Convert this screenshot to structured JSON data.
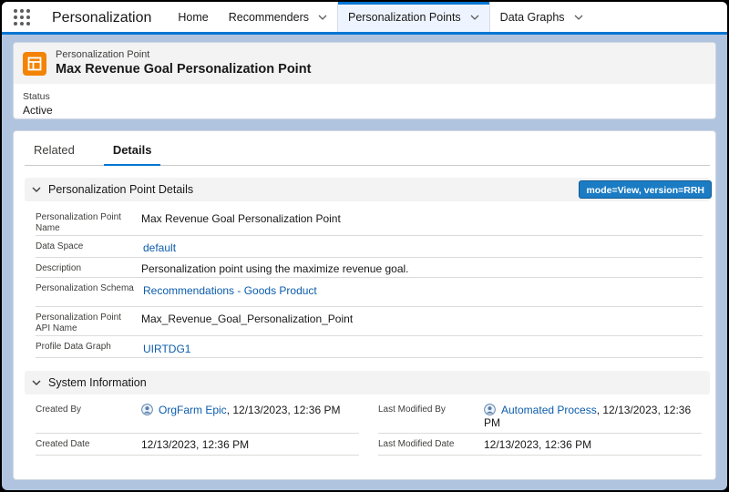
{
  "nav": {
    "app_name": "Personalization",
    "tabs": [
      {
        "label": "Home"
      },
      {
        "label": "Recommenders"
      },
      {
        "label": "Personalization Points"
      },
      {
        "label": "Data Graphs"
      }
    ]
  },
  "record": {
    "object_type": "Personalization Point",
    "title": "Max Revenue Goal Personalization Point",
    "status_label": "Status",
    "status_value": "Active"
  },
  "tabs": {
    "related": "Related",
    "details": "Details"
  },
  "details_section": {
    "title": "Personalization Point Details",
    "mode_badge": "mode=View, version=RRH",
    "fields": [
      {
        "label": "Personalization Point Name",
        "value": "Max Revenue Goal Personalization Point"
      },
      {
        "label": "Data Space",
        "value": "default"
      },
      {
        "label": "Description",
        "value": "Personalization point using the maximize revenue goal."
      },
      {
        "label": "Personalization Schema",
        "value": "Recommendations - Goods Product"
      },
      {
        "label": "Personalization Point API Name",
        "value": "Max_Revenue_Goal_Personalization_Point"
      },
      {
        "label": "Profile Data Graph",
        "value": "UIRTDG1"
      }
    ]
  },
  "system_section": {
    "title": "System Information",
    "created_by_label": "Created By",
    "created_by_user": "OrgFarm Epic",
    "created_by_date": ", 12/13/2023, 12:36 PM",
    "created_date_label": "Created Date",
    "created_date_value": "12/13/2023, 12:36 PM",
    "modified_by_label": "Last Modified By",
    "modified_by_user": "Automated Process",
    "modified_by_date_1": ", 12/13/2023, 12:36",
    "modified_by_date_2": "PM",
    "modified_date_label": "Last Modified Date",
    "modified_date_value": "12/13/2023, 12:36 PM"
  },
  "colors": {
    "brand_blue": "#0176d3",
    "link": "#0b5cab",
    "object_icon": "#f38303",
    "badge": "#1b7cc4"
  },
  "icons": {
    "app_launcher": "waffle-icon",
    "chevron": "chevron-down-icon",
    "object": "personalization-point-icon",
    "user": "user-avatar-icon"
  }
}
